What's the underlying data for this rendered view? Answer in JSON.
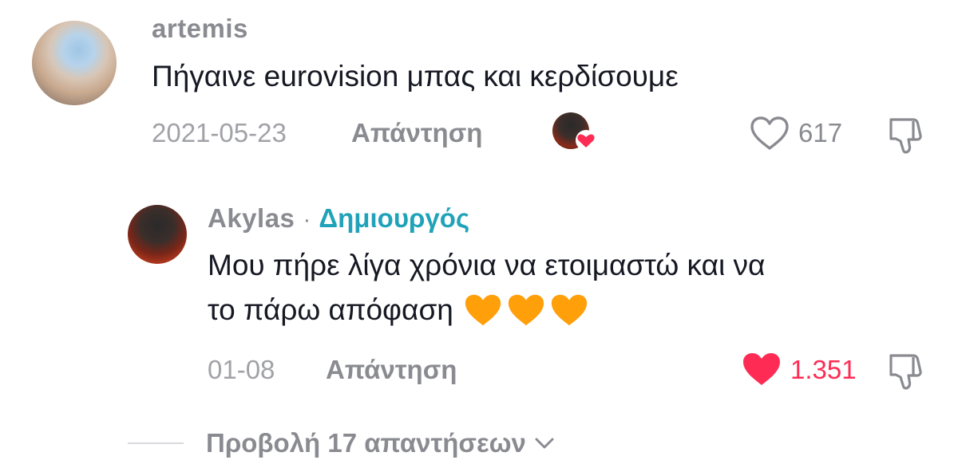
{
  "comment": {
    "username": "artemis",
    "text": "Πήγαινε eurovision μπας και κερδίσουμε",
    "date": "2021-05-23",
    "reply_label": "Απάντηση",
    "likes": "617",
    "liked_by_creator": true,
    "liked": false
  },
  "reply": {
    "username": "Akylas",
    "separator": "·",
    "badge": "Δημιουργός",
    "text_line1": "Μου πήρε λίγα χρόνια να ετοιμαστώ και να",
    "text_line2": "το πάρω απόφαση",
    "emojis": [
      "orange-heart",
      "orange-heart",
      "orange-heart"
    ],
    "date": "01-08",
    "reply_label": "Απάντηση",
    "likes": "1.351",
    "liked": true
  },
  "view_replies": {
    "label": "Προβολή 17 απαντήσεων"
  },
  "colors": {
    "like_active": "#fe2c55",
    "creator_badge": "#20a3b8",
    "secondary_text": "#8a8b91",
    "orange_heart": "#ff9f0a"
  }
}
